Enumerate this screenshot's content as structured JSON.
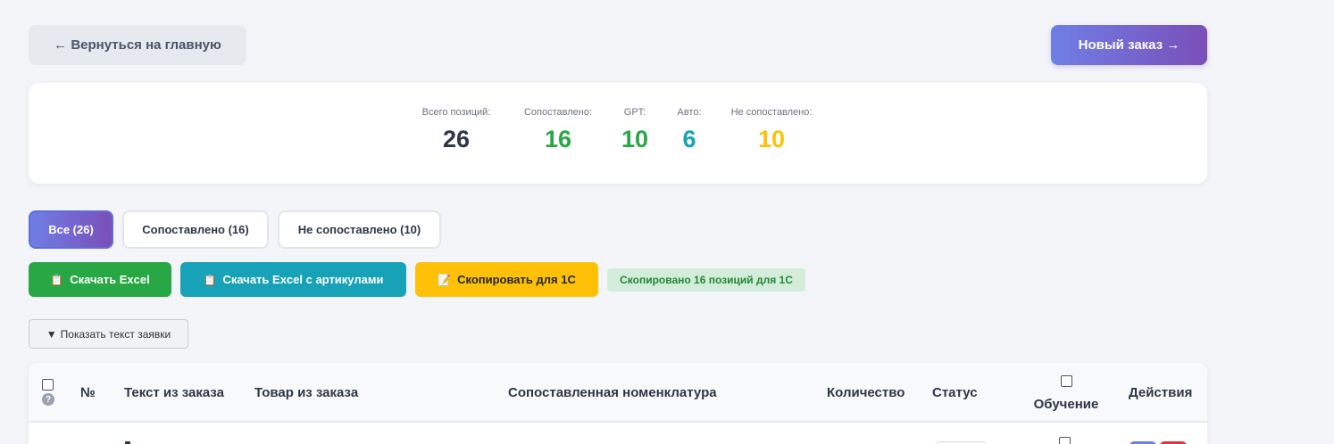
{
  "header": {
    "back_label": "← Вернуться на главную",
    "new_order_label": "Новый заказ →"
  },
  "stats": [
    {
      "label": "Всего позиций:",
      "value": "26",
      "color": "#2d3748"
    },
    {
      "label": "Сопоставлено:",
      "value": "16",
      "color": "#28a745"
    },
    {
      "label": "GPT:",
      "value": "10",
      "color": "#28a745"
    },
    {
      "label": "Авто:",
      "value": "6",
      "color": "#17a2b8"
    },
    {
      "label": "Не сопоставлено:",
      "value": "10",
      "color": "#ffc107"
    }
  ],
  "tabs": [
    {
      "label": "Все (26)",
      "active": true
    },
    {
      "label": "Сопоставлено (16)",
      "active": false
    },
    {
      "label": "Не сопоставлено (10)",
      "active": false
    }
  ],
  "actions": {
    "excel": {
      "label": "Скачать Excel",
      "icon": "clipboard-icon",
      "color": "#28a745"
    },
    "excel_articles": {
      "label": "Скачать Excel с артикулами",
      "icon": "clipboard-icon",
      "color": "#17a2b8"
    },
    "copy_1c": {
      "label": "Скопировать для 1С",
      "icon": "memo-icon",
      "color": "#ffc107"
    },
    "copied_message": "Скопировано 16 позиций для 1С"
  },
  "toggle": {
    "label": "Показать текст заявки",
    "icon": "triangle-down-icon"
  },
  "table": {
    "help_glyph": "?",
    "columns": {
      "number": "№",
      "order_text": "Текст из заказа",
      "order_product": "Товар из заказа",
      "matched": "Сопоставленная номенклатура",
      "quantity": "Количество",
      "status": "Статус",
      "training": "Обучение",
      "actions": "Действия"
    }
  },
  "colors": {
    "accent_start": "#6f7fe6",
    "accent_end": "#7a4fb8",
    "green": "#28a745",
    "teal": "#17a2b8",
    "yellow": "#ffc107",
    "red": "#dc3545"
  }
}
